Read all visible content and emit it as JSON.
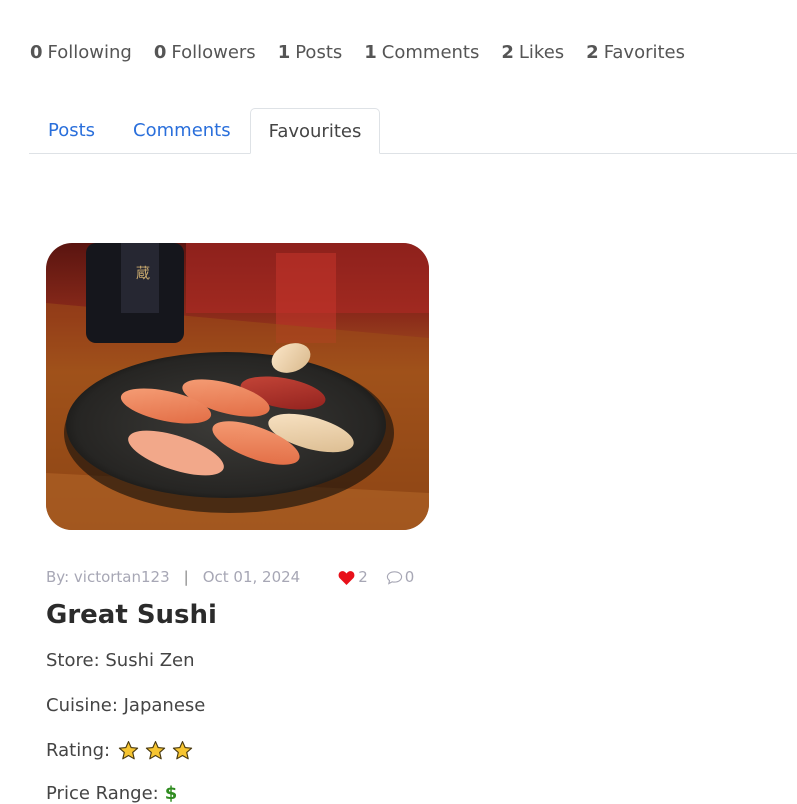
{
  "stats": [
    {
      "count": "0",
      "label": "Following"
    },
    {
      "count": "0",
      "label": "Followers"
    },
    {
      "count": "1",
      "label": "Posts"
    },
    {
      "count": "1",
      "label": "Comments"
    },
    {
      "count": "2",
      "label": "Likes"
    },
    {
      "count": "2",
      "label": "Favorites"
    }
  ],
  "tabs": [
    "Posts",
    "Comments",
    "Favourites"
  ],
  "active_tab": "Favourites",
  "post": {
    "author": "By: victortan123",
    "separator": "|",
    "date": "Oct 01, 2024",
    "likes": "2",
    "comments": "0",
    "title": "Great Sushi",
    "store": "Store: Sushi Zen",
    "cuisine": "Cuisine: Japanese",
    "rating_label": "Rating:",
    "rating": 3,
    "price_label": "Price Range:",
    "price_symbol": "$"
  },
  "colors": {
    "link": "#2a6fdb",
    "heart": "#e8101a",
    "meta": "#a7a7b5"
  }
}
